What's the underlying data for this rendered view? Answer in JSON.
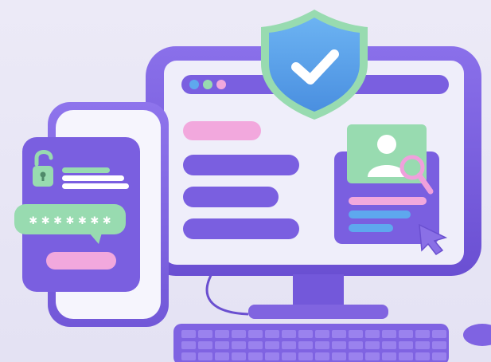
{
  "password": {
    "mask": "✱ ✱ ✱ ✱ ✱ ✱ ✱"
  },
  "colors": {
    "purple": "#7b5fe0",
    "purple_dark": "#6a4fd0",
    "screen_bg": "#efeefa",
    "green": "#98dbb0",
    "pink": "#f2a8dd",
    "blue": "#5ea8ee",
    "shield_blue": "#59a5e8"
  },
  "icons": {
    "shield": "shield-check-icon",
    "padlock": "unlocked-padlock-icon",
    "user": "user-avatar-icon",
    "magnifier": "magnifier-icon",
    "cursor": "pointer-cursor-icon"
  }
}
